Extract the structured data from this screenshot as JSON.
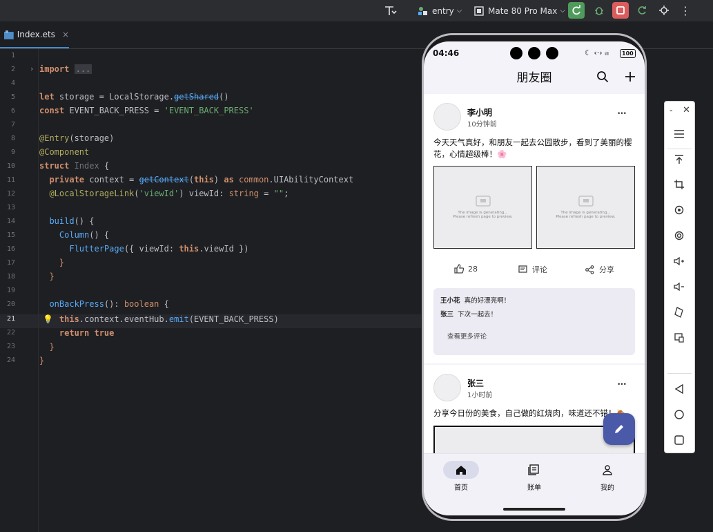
{
  "toolbar": {
    "module": "entry",
    "device": "Mate 80 Pro Max"
  },
  "tab": {
    "label": "Index.ets",
    "close": "×"
  },
  "editor": {
    "line_numbers": [
      "1",
      "2",
      "4",
      "5",
      "6",
      "7",
      "8",
      "9",
      "10",
      "11",
      "12",
      "13",
      "14",
      "15",
      "16",
      "17",
      "18",
      "19",
      "20",
      "21",
      "22",
      "23",
      "24"
    ],
    "code": {
      "l2_kw": "import",
      "l2_fold": "...",
      "l5_let": "let",
      "l5_a": " storage = LocalStorage.",
      "l5_fn": "getShared",
      "l5_b": "()",
      "l6_const": "const",
      "l6_a": " EVENT_BACK_PRESS = ",
      "l6_str": "'EVENT_BACK_PRESS'",
      "l8_ann": "@Entry",
      "l8_a": "(storage)",
      "l9_ann": "@Component",
      "l10_kw": "struct",
      "l10_name": " Index",
      "l10_b": " {",
      "l11_kw": "  private",
      "l11_a": " context = ",
      "l11_fn": "getContext",
      "l11_b": "(",
      "l11_this": "this",
      "l11_c": ") ",
      "l11_as": "as",
      "l11_d": " ",
      "l11_mod": "common",
      "l11_e": ".UIAbilityContext",
      "l12_ann": "  @LocalStorageLink",
      "l12_a": "(",
      "l12_str": "'viewId'",
      "l12_b": ") viewId: ",
      "l12_typ": "string",
      "l12_c": " = ",
      "l12_str2": "\"\"",
      "l12_d": ";",
      "l14_fn": "  build",
      "l14_a": "() {",
      "l15_fn": "    Column",
      "l15_a": "() {",
      "l16_fn": "      FlutterPage",
      "l16_a": "({ viewId: ",
      "l16_this": "this",
      "l16_b": ".viewId })",
      "l17": "    }",
      "l18": "  }",
      "l20_fn": "  onBackPress",
      "l20_a": "(): ",
      "l20_typ": "boolean",
      "l20_b": " {",
      "l21_this": "    this",
      "l21_a": ".context.eventHub.",
      "l21_fn": "emit",
      "l21_b": "(EVENT_BACK_PRESS)",
      "l22_kw": "    return",
      "l22_val": " true",
      "l23": "  }",
      "l24": "}"
    }
  },
  "phone": {
    "status": {
      "time": "04:46",
      "battery": "100"
    },
    "app_title": "朋友圈",
    "posts": [
      {
        "user": "李小明",
        "time": "10分钟前",
        "text": "今天天气真好，和朋友一起去公园散步，看到了美丽的樱花，心情超级棒！🌸",
        "likes": "28",
        "comment_label": "评论",
        "share_label": "分享",
        "image_placeholder_1": "The image is generating...",
        "image_placeholder_2": "Please refresh page to preview.",
        "comments": [
          {
            "name": "王小花",
            "text": "真的好漂亮啊！"
          },
          {
            "name": "张三",
            "text": "下次一起去！"
          }
        ],
        "more_comments": "查看更多评论"
      },
      {
        "user": "张三",
        "time": "1小时前",
        "text": "分享今日份的美食，自己做的红烧肉，味道还不错！🍖"
      }
    ],
    "more_glyph": "•••",
    "nav": [
      {
        "label": "首页",
        "icon": "home-icon"
      },
      {
        "label": "账单",
        "icon": "bill-icon"
      },
      {
        "label": "我的",
        "icon": "person-icon"
      }
    ]
  },
  "colors": {
    "editor_bg": "#1e1f22",
    "keyword": "#cf8e6d",
    "string": "#6aab73",
    "function": "#57aaf7",
    "annotation": "#b3ae60",
    "fab": "#4b5aa8",
    "nav_active": "#d9dbeb"
  }
}
